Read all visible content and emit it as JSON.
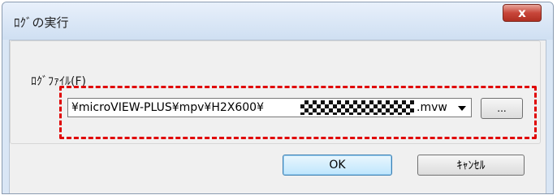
{
  "dialog": {
    "title": "ﾛｸﾞの実行",
    "close_label": "x"
  },
  "log_file": {
    "label": "ﾛｸﾞﾌｧｲﾙ(F)",
    "path_prefix": "¥microVIEW-PLUS¥mpv¥H2X600¥",
    "path_suffix": ".mvw",
    "browse_label": "..."
  },
  "buttons": {
    "ok": "OK",
    "cancel": "ｷｬﾝｾﾙ"
  },
  "colors": {
    "highlight": "#e00000",
    "close_button": "#c8463a"
  }
}
